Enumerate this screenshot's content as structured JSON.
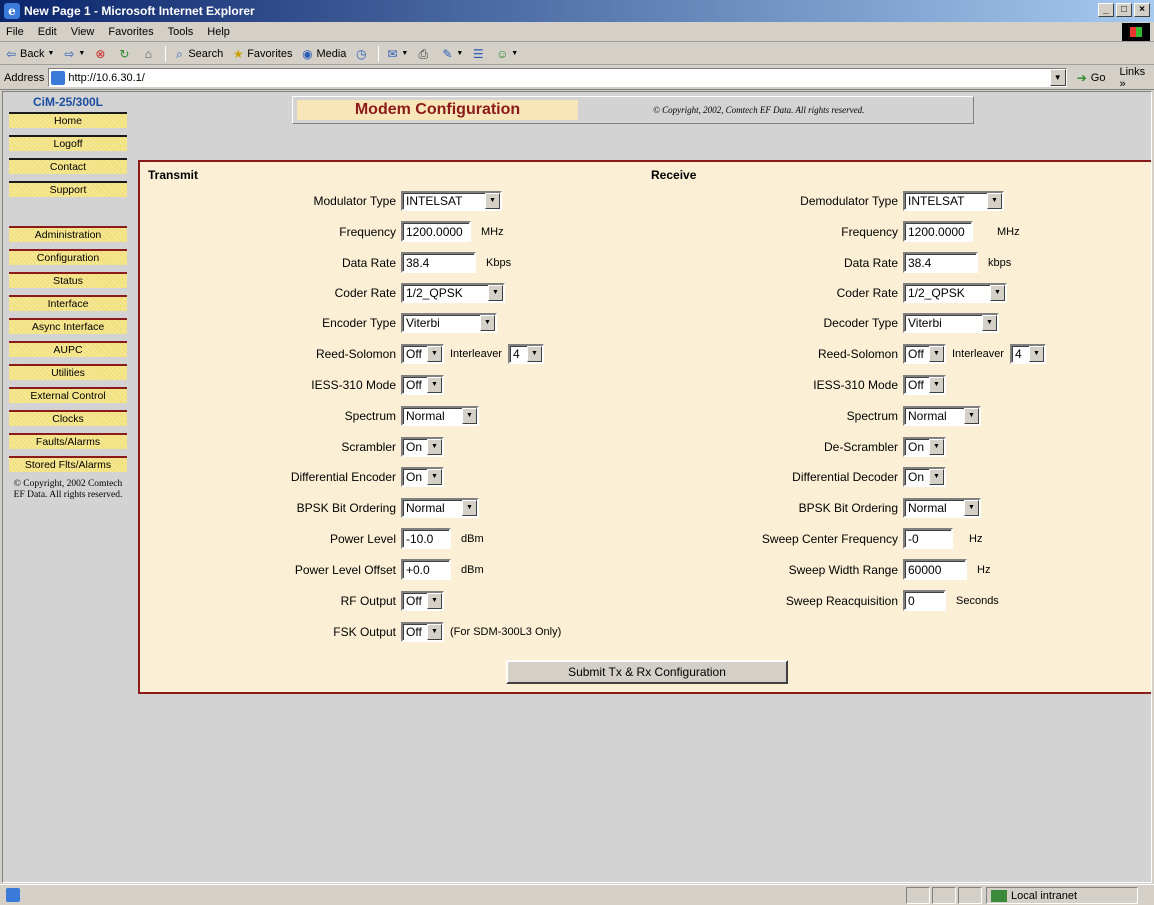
{
  "window": {
    "title": "New Page 1 - Microsoft Internet Explorer"
  },
  "menu": [
    "File",
    "Edit",
    "View",
    "Favorites",
    "Tools",
    "Help"
  ],
  "toolbar": {
    "back": "Back",
    "search": "Search",
    "favorites": "Favorites",
    "media": "Media"
  },
  "address": {
    "label": "Address",
    "url": "http://10.6.30.1/",
    "go": "Go",
    "links": "Links"
  },
  "sidebar": {
    "model": "CiM-25/300L",
    "group1": [
      "Home",
      "Logoff",
      "Contact",
      "Support"
    ],
    "group2": [
      "Administration",
      "Configuration",
      "Status",
      "Interface",
      "Async Interface",
      "AUPC",
      "Utilities",
      "External Control",
      "Clocks",
      "Faults/Alarms",
      "Stored Flts/Alarms"
    ],
    "copyright": "© Copyright, 2002 Comtech EF Data. All rights reserved."
  },
  "header": {
    "title": "Modem Configuration",
    "copyright": "© Copyright, 2002, Comtech EF Data. All rights reserved."
  },
  "transmit": {
    "title": "Transmit",
    "modulator_type": {
      "label": "Modulator Type",
      "value": "INTELSAT"
    },
    "frequency": {
      "label": "Frequency",
      "value": "1200.0000",
      "unit": "MHz"
    },
    "data_rate": {
      "label": "Data Rate",
      "value": "38.4",
      "unit": "Kbps"
    },
    "coder_rate": {
      "label": "Coder Rate",
      "value": "1/2_QPSK"
    },
    "encoder_type": {
      "label": "Encoder Type",
      "value": "Viterbi"
    },
    "reed_solomon": {
      "label": "Reed-Solomon",
      "value": "Off",
      "interleaver_label": "Interleaver",
      "interleaver_value": "4"
    },
    "iess_mode": {
      "label": "IESS-310 Mode",
      "value": "Off"
    },
    "spectrum": {
      "label": "Spectrum",
      "value": "Normal"
    },
    "scrambler": {
      "label": "Scrambler",
      "value": "On"
    },
    "differential": {
      "label": "Differential Encoder",
      "value": "On"
    },
    "bpsk": {
      "label": "BPSK Bit Ordering",
      "value": "Normal"
    },
    "power_level": {
      "label": "Power Level",
      "value": "-10.0",
      "unit": "dBm"
    },
    "power_offset": {
      "label": "Power Level Offset",
      "value": "+0.0",
      "unit": "dBm"
    },
    "rf_output": {
      "label": "RF Output",
      "value": "Off"
    },
    "fsk_output": {
      "label": "FSK Output",
      "value": "Off",
      "note": "(For SDM-300L3 Only)"
    }
  },
  "receive": {
    "title": "Receive",
    "demodulator_type": {
      "label": "Demodulator Type",
      "value": "INTELSAT"
    },
    "frequency": {
      "label": "Frequency",
      "value": "1200.0000",
      "unit": "MHz"
    },
    "data_rate": {
      "label": "Data Rate",
      "value": "38.4",
      "unit": "kbps"
    },
    "coder_rate": {
      "label": "Coder Rate",
      "value": "1/2_QPSK"
    },
    "decoder_type": {
      "label": "Decoder Type",
      "value": "Viterbi"
    },
    "reed_solomon": {
      "label": "Reed-Solomon",
      "value": "Off",
      "interleaver_label": "Interleaver",
      "interleaver_value": "4"
    },
    "iess_mode": {
      "label": "IESS-310 Mode",
      "value": "Off"
    },
    "spectrum": {
      "label": "Spectrum",
      "value": "Normal"
    },
    "descrambler": {
      "label": "De-Scrambler",
      "value": "On"
    },
    "differential": {
      "label": "Differential Decoder",
      "value": "On"
    },
    "bpsk": {
      "label": "BPSK Bit Ordering",
      "value": "Normal"
    },
    "sweep_center": {
      "label": "Sweep Center Frequency",
      "value": "-0",
      "unit": "Hz"
    },
    "sweep_width": {
      "label": "Sweep Width Range",
      "value": "60000",
      "unit": "Hz"
    },
    "sweep_reacq": {
      "label": "Sweep Reacquisition",
      "value": "0",
      "unit": "Seconds"
    }
  },
  "submit_label": "Submit Tx & Rx Configuration",
  "status": {
    "zone": "Local intranet"
  }
}
